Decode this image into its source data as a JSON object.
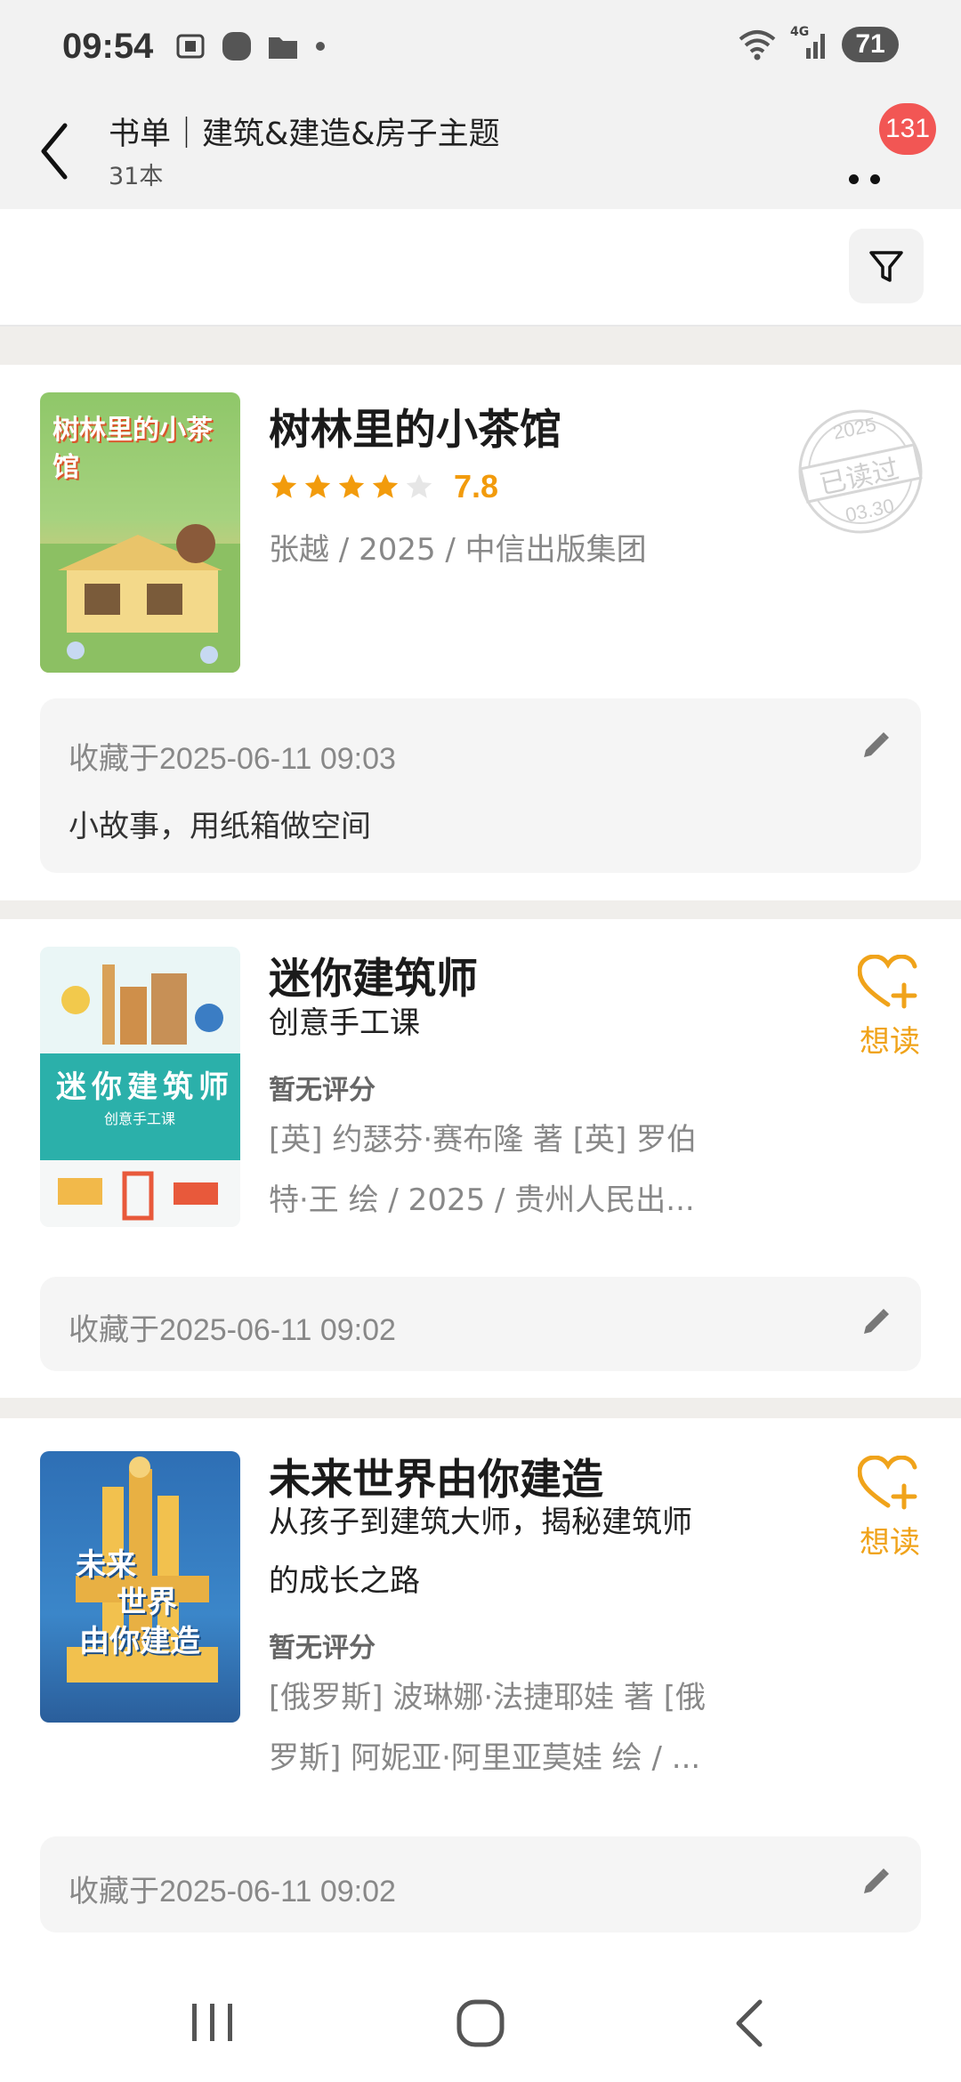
{
  "status_bar": {
    "time": "09:54",
    "battery": "71",
    "network": "4G"
  },
  "header": {
    "title": "书单｜建筑&建造&房子主题",
    "count": "31本",
    "badge": "131"
  },
  "books": [
    {
      "title": "树林里的小茶馆",
      "rating": "7.8",
      "stars": 4,
      "meta": "张越 / 2025 / 中信出版集团",
      "cover_text": "树林里的小茶馆",
      "stamp_year": "2025",
      "stamp_text": "已读过",
      "stamp_date": "03.30",
      "note_date": "收藏于2025-06-11 09:03",
      "note_text": "小故事，用纸箱做空间"
    },
    {
      "title": "迷你建筑师",
      "subtitle": "创意手工课",
      "rating_text": "暂无评分",
      "meta_line1": "[英] 约瑟芬·赛布隆 著 [英] 罗伯",
      "meta_line2": "特·王 绘 / 2025 / 贵州人民出...",
      "cover_text": "迷你建筑师",
      "cover_sub": "创意手工课",
      "want_label": "想读",
      "note_date": "收藏于2025-06-11 09:02"
    },
    {
      "title": "未来世界由你建造",
      "subtitle_line1": "从孩子到建筑大师，揭秘建筑师",
      "subtitle_line2": "的成长之路",
      "rating_text": "暂无评分",
      "meta_line1": "[俄罗斯] 波琳娜·法捷耶娃 著 [俄",
      "meta_line2": "罗斯] 阿妮亚·阿里亚莫娃 绘 / ...",
      "cover_text_1": "未来",
      "cover_text_2": "世界",
      "cover_text_3": "由你建造",
      "want_label": "想读",
      "note_date": "收藏于2025-06-11 09:02"
    }
  ],
  "colors": {
    "accent_orange": "#f29b0c",
    "badge_red": "#f25654",
    "want_orange": "#f0a31a"
  }
}
